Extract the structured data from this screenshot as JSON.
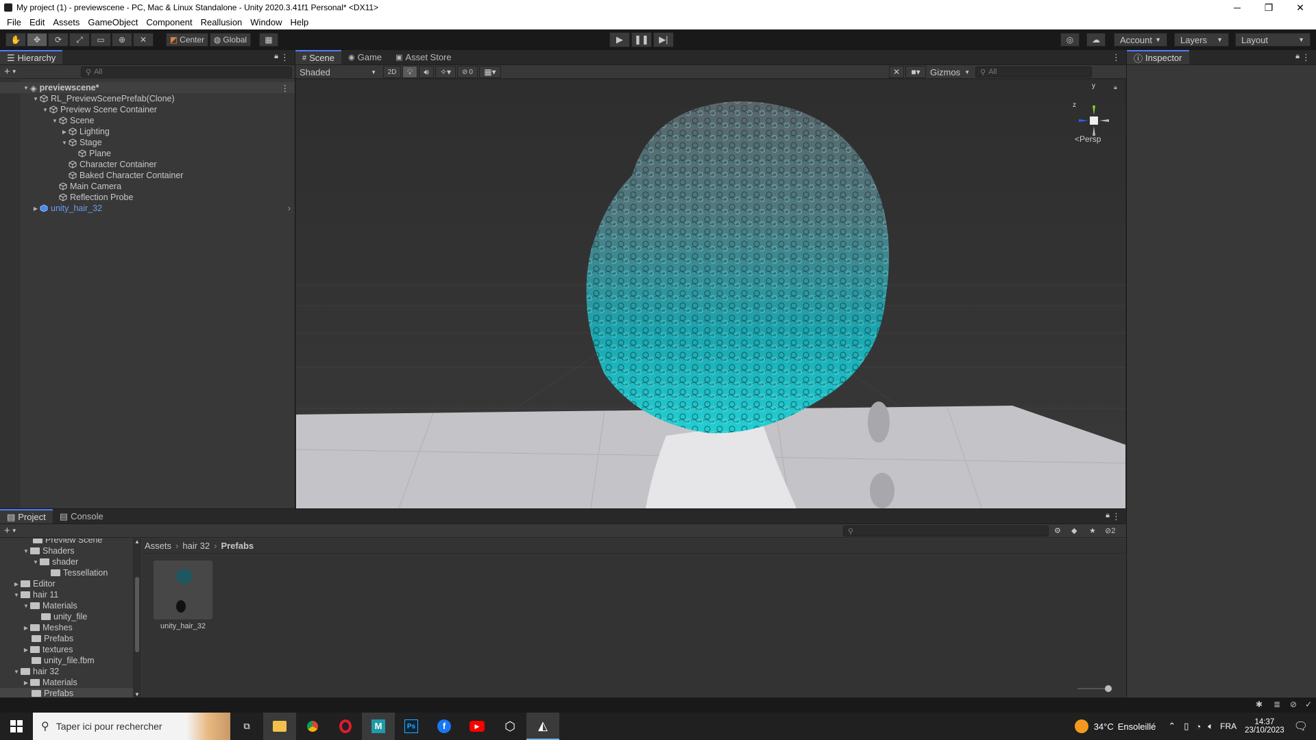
{
  "window": {
    "title": "My project (1) - previewscene - PC, Mac & Linux Standalone - Unity 2020.3.41f1 Personal* <DX11>",
    "minimize": "─",
    "maximize": "❐",
    "close": "✕"
  },
  "menu": [
    "File",
    "Edit",
    "Assets",
    "GameObject",
    "Component",
    "Reallusion",
    "Window",
    "Help"
  ],
  "toolbar": {
    "pivot_label": "Center",
    "space_label": "Global",
    "account_label": "Account",
    "layers_label": "Layers",
    "layout_label": "Layout"
  },
  "hierarchy": {
    "tab_label": "Hierarchy",
    "search_placeholder": "All",
    "scene_name": "previewscene*",
    "items": [
      {
        "label": "RL_PreviewScenePrefab(Clone)"
      },
      {
        "label": "Preview Scene Container"
      },
      {
        "label": "Scene"
      },
      {
        "label": "Lighting"
      },
      {
        "label": "Stage"
      },
      {
        "label": "Plane"
      },
      {
        "label": "Character Container"
      },
      {
        "label": "Baked Character Container"
      },
      {
        "label": "Main Camera"
      },
      {
        "label": "Reflection Probe"
      },
      {
        "label": "unity_hair_32"
      }
    ]
  },
  "scene_view": {
    "tabs": [
      "Scene",
      "Game",
      "Asset Store"
    ],
    "shading_mode": "Shaded",
    "mode_2d": "2D",
    "hidden_count": "0",
    "gizmos_label": "Gizmos",
    "search_placeholder": "All",
    "projection_label": "Persp",
    "axis_y": "y",
    "axis_z": "z"
  },
  "inspector": {
    "tab_label": "Inspector"
  },
  "project": {
    "tabs": [
      "Project",
      "Console"
    ],
    "layer_count": "2",
    "tree": [
      {
        "label": "Preview Scene"
      },
      {
        "label": "Shaders"
      },
      {
        "label": "shader"
      },
      {
        "label": "Tessellation"
      },
      {
        "label": "Editor"
      },
      {
        "label": "hair 11"
      },
      {
        "label": "Materials"
      },
      {
        "label": "unity_file"
      },
      {
        "label": "Meshes"
      },
      {
        "label": "Prefabs"
      },
      {
        "label": "textures"
      },
      {
        "label": "unity_file.fbm"
      },
      {
        "label": "hair 32"
      },
      {
        "label": "Materials"
      },
      {
        "label": "Prefabs"
      }
    ],
    "breadcrumb": [
      "Assets",
      "hair 32",
      "Prefabs"
    ],
    "assets": [
      {
        "label": "unity_hair_32"
      }
    ]
  },
  "taskbar": {
    "search_placeholder": "Taper ici pour rechercher",
    "weather_temp": "34°C",
    "weather_text": "Ensoleillé",
    "language": "FRA",
    "time": "14:37",
    "date": "23/10/2023"
  },
  "colors": {
    "accent": "#4c7eff",
    "panel": "#383838",
    "hair_top": "#6e7a80",
    "hair_bottom": "#1ec8cc"
  }
}
